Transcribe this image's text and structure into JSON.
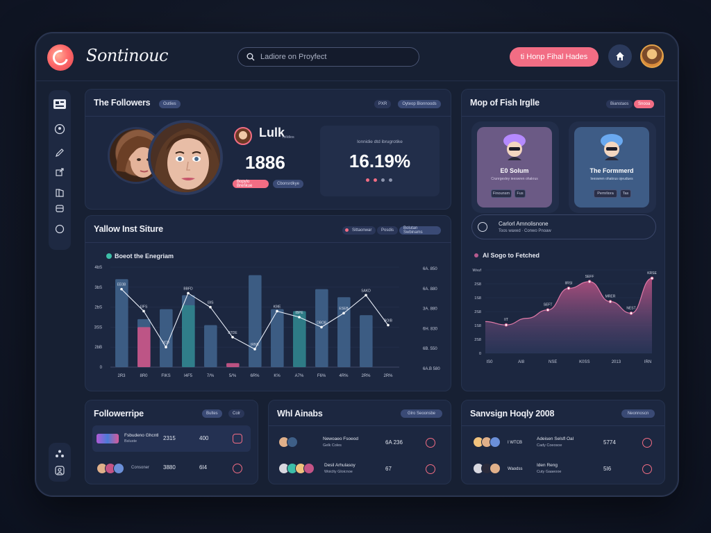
{
  "header": {
    "brand": "Sontinouc",
    "search_placeholder": "Ladiore on Proyfect",
    "cta_label": "ti Honp Fihal Hades"
  },
  "followers_card": {
    "title": "The Followers",
    "title_badge": "Outlies",
    "top_pills": [
      "PXR",
      "Oyteop Bionnoods"
    ],
    "user_name": "Lulk",
    "user_sub": "Ivildios",
    "count": "1886",
    "pill_pink": "Bopylo Brenkue",
    "pill_blue": "Cbonsrdkye",
    "box_label": "Ionnidie dtd ibrugrotike",
    "percent": "16.19%",
    "dot_colors": [
      "#f26d84",
      "#f26d84",
      "#8c94ad",
      "#8c94ad"
    ]
  },
  "map_card": {
    "title": "Mop of Fish Irglle",
    "pills": [
      "Bianstaos",
      "Snooa"
    ],
    "tiles": [
      {
        "name": "E0 Solum",
        "sub": "Crunrgesley ieeswren ohakrus",
        "btn1": "Finounsm",
        "btn2": "Fus",
        "bg": "#6b5a85"
      },
      {
        "name": "The Formmerd",
        "sub": "Ieeswren ohakrus ojeudues",
        "btn1": "Pemrliora",
        "btn2": "Tas",
        "bg": "#3e5c86"
      }
    ],
    "row_title": "Carlorl Amnolisnone",
    "row_sub": "Toos waxed · Conwo Pnoaw"
  },
  "main_chart_card": {
    "title": "Yallow Inst Siture",
    "pills": [
      "Sittaonwar",
      "Posdis",
      "Bolutan Swbinams"
    ],
    "legend": "Boeot the Enegriam"
  },
  "area_chart_card": {
    "legend": "AI Sogo to Fetched"
  },
  "chart_data": [
    {
      "type": "bar",
      "title": "Yallow Inst Siture",
      "categories": [
        "2R3",
        "8R0",
        "FIKS",
        "I4F5",
        "7/%",
        "5/% ",
        "6R%",
        "K%",
        "A7%",
        "F6%",
        "4R%",
        "2R%",
        "2R%"
      ],
      "ytick_labels": [
        "0",
        "2bB",
        "3SS",
        "2bS",
        "3bS",
        "4bS"
      ],
      "right_tick_labels": [
        "6A. 850",
        "6A. 880",
        "3A. 880",
        "6H. 830",
        "6B. 550",
        "6A.B 580"
      ],
      "ylim": [
        0,
        100
      ],
      "series": [
        {
          "name": "",
          "values": [
            88,
            48,
            58,
            72,
            42,
            0,
            92,
            58,
            0,
            78,
            70,
            52,
            0
          ],
          "color": "#3e5f87"
        },
        {
          "name": "",
          "values": [
            0,
            40,
            0,
            0,
            0,
            4,
            0,
            0,
            0,
            0,
            0,
            0,
            0
          ],
          "color": "#c45486"
        },
        {
          "name": "",
          "values": [
            0,
            0,
            0,
            62,
            0,
            0,
            0,
            0,
            56,
            0,
            0,
            0,
            0
          ],
          "color": "#2f7f8a"
        }
      ],
      "line": [
        78,
        56,
        20,
        74,
        60,
        30,
        18,
        56,
        50,
        40,
        54,
        72,
        42
      ],
      "point_labels": [
        "EE0B",
        "I3FS",
        "IICD",
        "BBFD",
        "I3IS",
        "BTDE",
        "IRNE",
        "K9IE",
        "IBPE",
        "DBO8",
        "ESEB",
        "SAKD",
        "BOIB"
      ]
    },
    {
      "type": "area",
      "title": "AI Sogo to Fetched",
      "categories": [
        "IS0",
        "AI8",
        "NSE",
        "K0SS",
        "2013",
        "IRN"
      ],
      "ytick_labels": [
        "0",
        "2S8",
        "1S8",
        "2S8",
        "1S8",
        "2S8",
        "Wvuf"
      ],
      "ylim": [
        0,
        100
      ],
      "values": [
        38,
        34,
        42,
        52,
        78,
        86,
        62,
        48,
        90
      ],
      "point_labels": [
        "IIT",
        "SEFT",
        "IIRSI",
        "SEFF",
        "MRER",
        "NEST",
        "KRSE"
      ],
      "color": "#c45486"
    }
  ],
  "followers_list": {
    "title": "Followerripe",
    "pills": [
      "Bultes",
      "Colr"
    ],
    "rows": [
      {
        "name": "Fsbudeno Ghcntl",
        "sub": "Bsluste",
        "v1": "2315",
        "v2": "400"
      },
      {
        "name": "",
        "sub": "Consoner",
        "v1": "3880",
        "v2": "6I4"
      }
    ]
  },
  "whl_card": {
    "title": "Whl Ainabs",
    "pill": "Glro Seoonsbe",
    "rows": [
      {
        "name": "Newoaeo Fsoeod",
        "sub": "Gelk   Coles",
        "value": "6A 236"
      },
      {
        "name": "Desil Arhulasoy",
        "sub": "Woiclty   Gloicnoe",
        "value": "67"
      }
    ]
  },
  "sanvesign_card": {
    "title": "Sanvsign Hoqly 2008",
    "pill": "Neonnoscn",
    "rows": [
      {
        "tag": "I WTCB",
        "name": "Adeisen Selsfl Oal",
        "sub": "Cady   Coeosoe",
        "value": "5774"
      },
      {
        "tag": "Waodss",
        "name": "Iden Reng",
        "sub": "Cuty   Gaaeooe",
        "value": "5I6"
      }
    ]
  }
}
